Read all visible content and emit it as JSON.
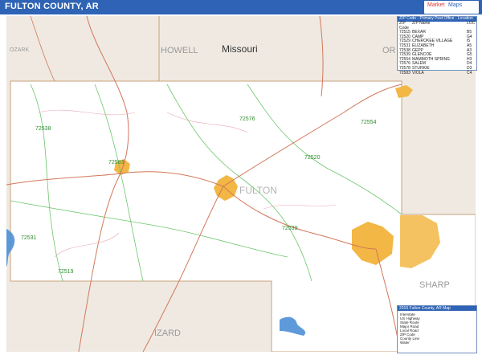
{
  "title": "FULTON COUNTY, AR",
  "logo": {
    "text_a": "Market",
    "text_b": "Maps"
  },
  "map_labels": {
    "state": "Missouri",
    "county_main": "FULTON",
    "neighbors": {
      "howell": "HOWELL",
      "oz": "OZARK",
      "oregon_partial": "OR",
      "sharp": "SHARP",
      "izard": "IZARD"
    },
    "zips": {
      "z1": "72538",
      "z2": "72583",
      "z3": "72576",
      "z4": "72554",
      "z5": "72520",
      "z6": "72539",
      "z7": "72531",
      "z8": "72519"
    }
  },
  "zip_table": {
    "header": "ZIP Code - Primary Post Office - Location",
    "columns": [
      "ZIP Code",
      "ZIP Name",
      "LOC"
    ],
    "rows": [
      {
        "zip": "72515",
        "name": "BEXAR",
        "loc": "B5"
      },
      {
        "zip": "72520",
        "name": "CAMP",
        "loc": "G4"
      },
      {
        "zip": "72529",
        "name": "CHEROKEE VILLAGE",
        "loc": "I5"
      },
      {
        "zip": "72531",
        "name": "ELIZABETH",
        "loc": "A5"
      },
      {
        "zip": "72538",
        "name": "GEPP",
        "loc": "A3"
      },
      {
        "zip": "72539",
        "name": "GLENCOE",
        "loc": "G5"
      },
      {
        "zip": "72554",
        "name": "MAMMOTH SPRING",
        "loc": "H3"
      },
      {
        "zip": "72576",
        "name": "SALEM",
        "loc": "D4"
      },
      {
        "zip": "72578",
        "name": "STURKIE",
        "loc": "D3"
      },
      {
        "zip": "72583",
        "name": "VIOLA",
        "loc": "C4"
      }
    ]
  },
  "legend": {
    "header": "2016 Fulton County, AR Map",
    "items": [
      "Interstate",
      "US Highway",
      "State Route",
      "Major Road",
      "Local Road",
      "ZIP Code",
      "County Line",
      "Water"
    ]
  },
  "colors": {
    "county_fill": "#ffffff",
    "outside_fill": "#efe9e2",
    "road": "#d2785a",
    "zip_line": "#6cc66c",
    "water": "#4d8fd6",
    "urban": "#f2b744",
    "header": "#2e63b5"
  }
}
